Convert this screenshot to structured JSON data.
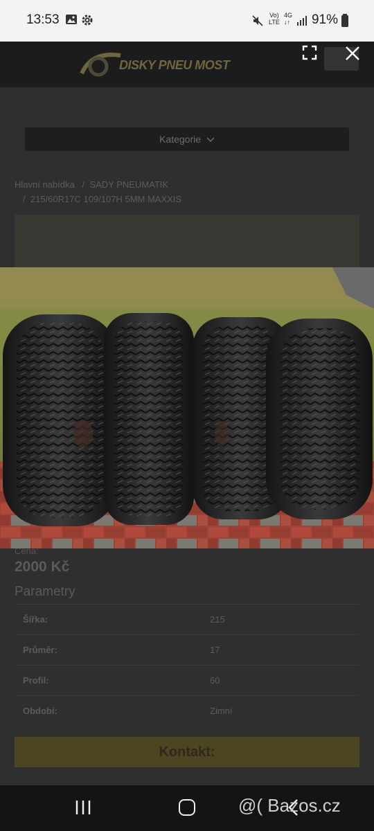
{
  "status_bar": {
    "time": "13:53",
    "icons": [
      "image-icon",
      "gear-icon",
      "mute-icon",
      "volte-icon",
      "4g-icon",
      "signal-icon"
    ],
    "network_top": "Vo)",
    "network_bottom": "LTE",
    "net_type": "4G",
    "battery": "91%"
  },
  "header": {
    "logo_text": "DISKY PNEU MOST"
  },
  "viewer": {
    "expand_icon": "expand-icon",
    "close_icon": "close-icon"
  },
  "category_button": {
    "label": "Kategorie",
    "icon": "chevron-down-icon"
  },
  "breadcrumb": {
    "items": [
      "Hlavní nabídka",
      "SADY PNEUMATIK",
      "215/60R17C 109/107H 5MM MAXXIS"
    ],
    "separator": "/"
  },
  "product": {
    "price_label": "Cena:",
    "price": "2000 Kč",
    "params_title": "Parametry",
    "params": [
      {
        "key": "Šířka:",
        "value": "215"
      },
      {
        "key": "Průměr:",
        "value": "17"
      },
      {
        "key": "Profil:",
        "value": "60"
      },
      {
        "key": "Období:",
        "value": "Zimní"
      }
    ],
    "contact_label": "Kontakt:"
  },
  "watermark": "@( Bazos.cz",
  "nav": {
    "recent_icon": "recent-apps-icon",
    "home_icon": "home-icon",
    "back_icon": "back-icon"
  }
}
